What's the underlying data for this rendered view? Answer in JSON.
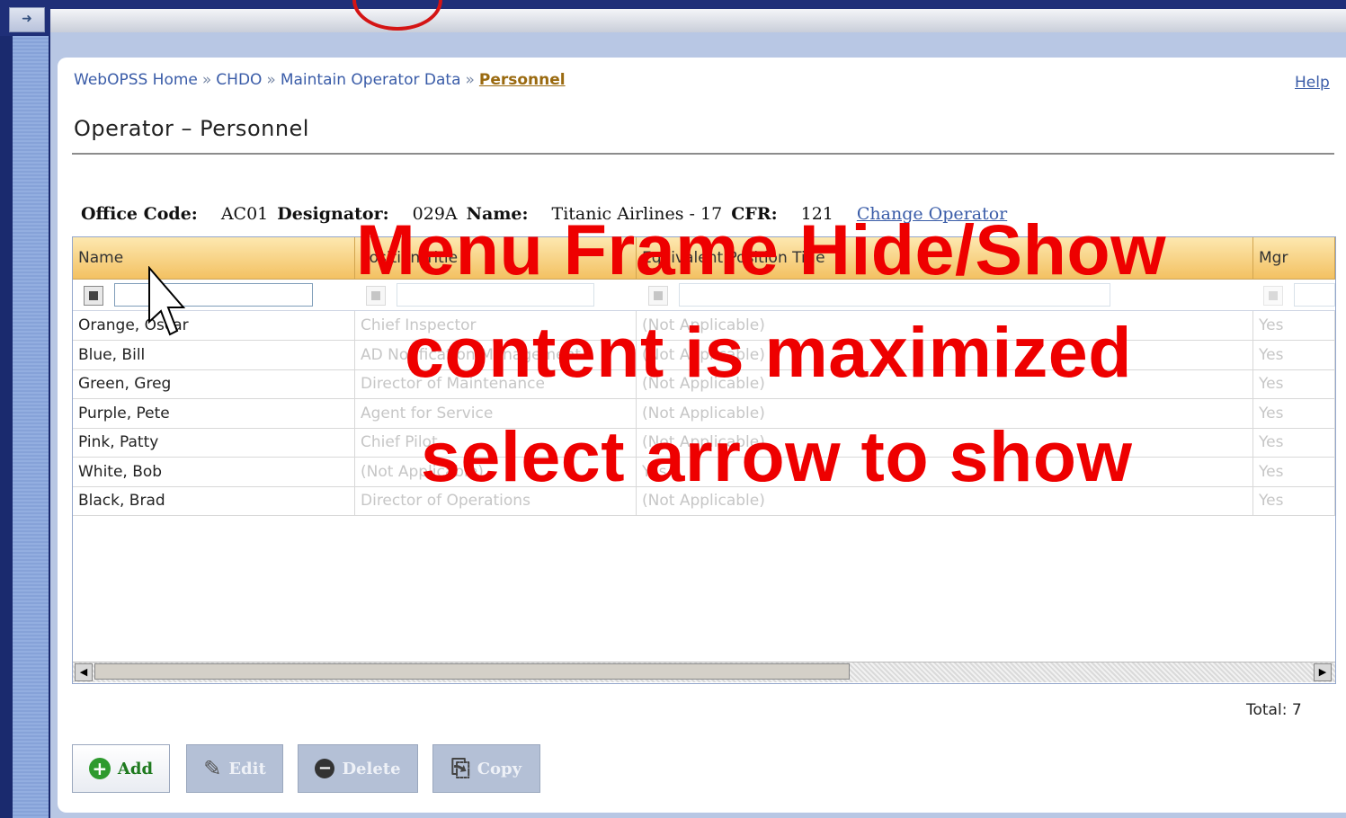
{
  "breadcrumb": {
    "home": "WebOPSS Home",
    "separator": "»",
    "section": "CHDO",
    "subsection": "Maintain Operator Data",
    "current": "Personnel"
  },
  "help_label": "Help",
  "page_title": "Operator – Personnel",
  "operator_info": {
    "office_code_label": "Office Code:",
    "office_code": "AC01",
    "designator_label": "Designator:",
    "designator": "029A",
    "name_label": "Name:",
    "name": "Titanic Airlines - 17",
    "cfr_label": "CFR:",
    "cfr": "121",
    "change_operator_label": "Change Operator"
  },
  "grid": {
    "columns": [
      "Name",
      "Position Title",
      "Equivalent Position Title",
      "Mgr"
    ],
    "rows": [
      {
        "name": "Orange, Oscar",
        "position": "Chief Inspector",
        "equivalent": "(Not Applicable)",
        "flag": "Yes"
      },
      {
        "name": "Blue, Bill",
        "position": "AD Notification Management",
        "equivalent": "(Not Applicable)",
        "flag": "Yes"
      },
      {
        "name": "Green, Greg",
        "position": "Director of Maintenance",
        "equivalent": "(Not Applicable)",
        "flag": "Yes"
      },
      {
        "name": "Purple, Pete",
        "position": "Agent for Service",
        "equivalent": "(Not Applicable)",
        "flag": "Yes"
      },
      {
        "name": "Pink, Patty",
        "position": "Chief Pilot",
        "equivalent": "(Not Applicable)",
        "flag": "Yes"
      },
      {
        "name": "White, Bob",
        "position": "(Not Applicable)",
        "equivalent": "Yes",
        "flag": "Yes"
      },
      {
        "name": "Black, Brad",
        "position": "Director of Operations",
        "equivalent": "(Not Applicable)",
        "flag": "Yes"
      }
    ],
    "total_label": "Total: 7"
  },
  "annotation": {
    "line1": "Menu Frame Hide/Show",
    "line2": "content is maximized",
    "line3": "select arrow to show"
  },
  "buttons": {
    "add": "Add",
    "edit": "Edit",
    "delete": "Delete",
    "copy": "Copy"
  },
  "icons": {
    "frame_toggle": "arrow-right-icon",
    "add": "plus-circle-icon",
    "edit": "pencil-icon",
    "delete": "minus-circle-icon",
    "copy": "copy-icon",
    "filter": "filter-icon"
  },
  "colors": {
    "annotation": "#ee0000",
    "header_bg": "#f3c162",
    "link": "#3a5ca8",
    "frame_bg": "#1f2f78"
  }
}
